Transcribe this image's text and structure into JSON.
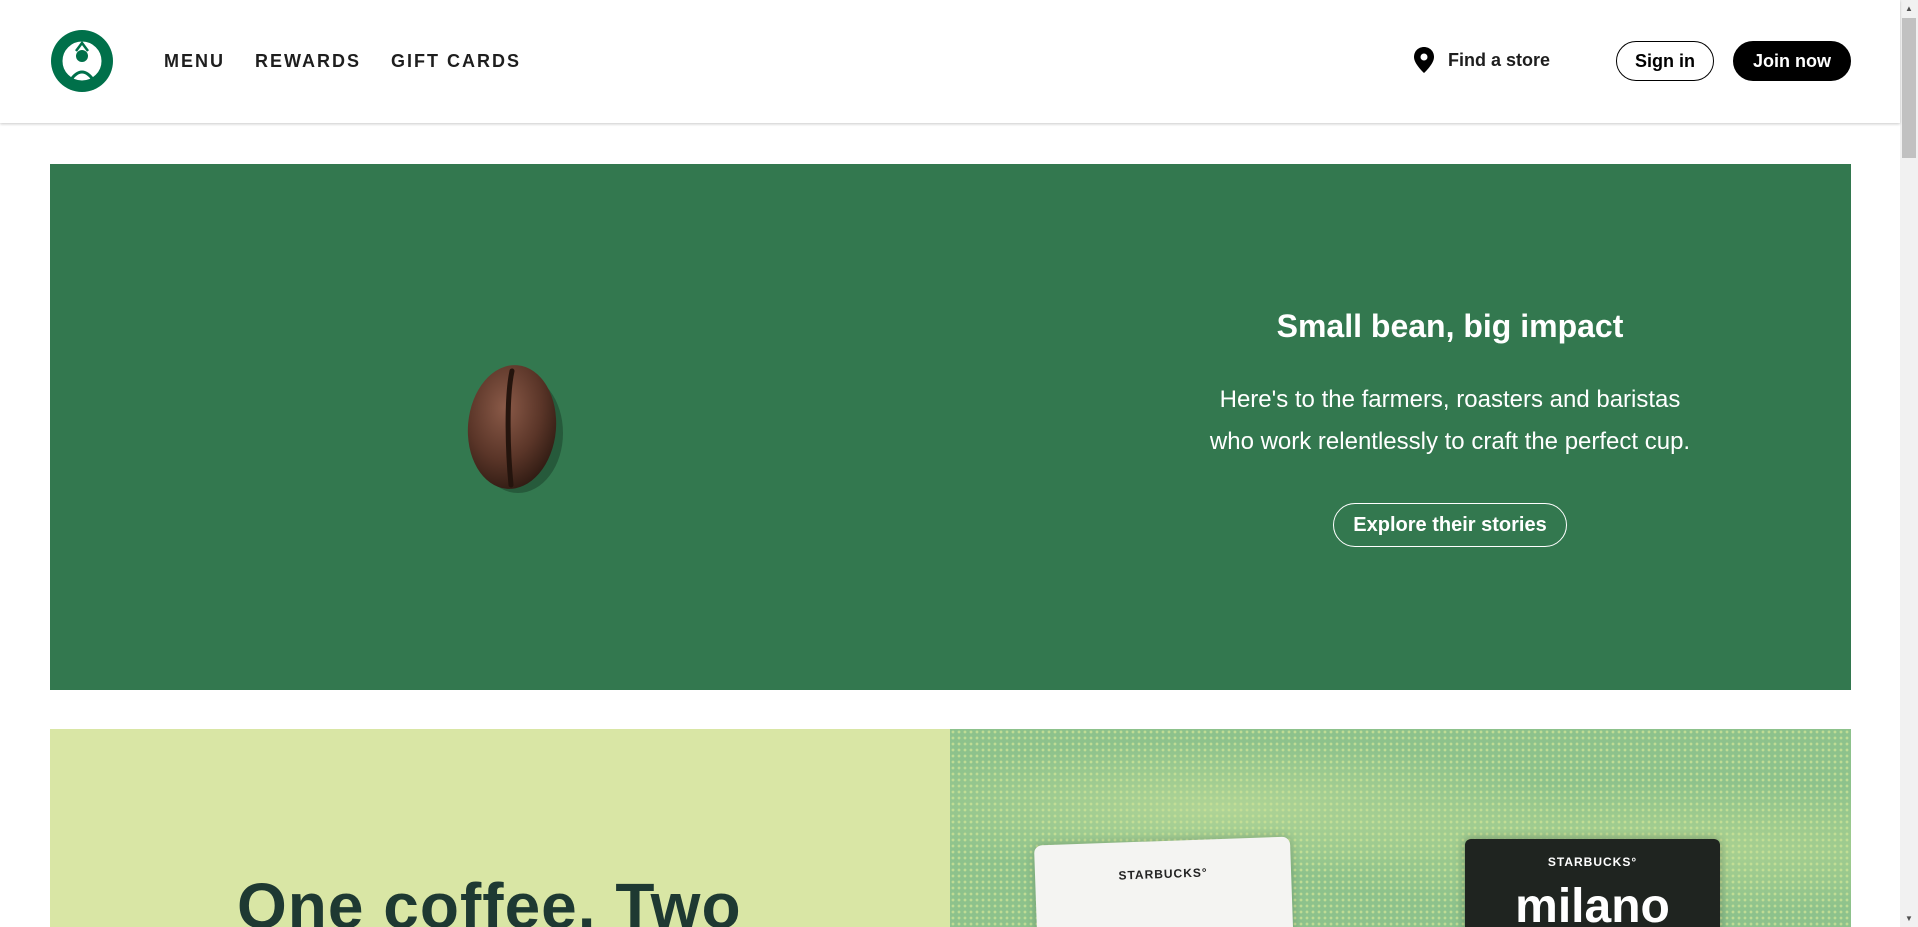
{
  "header": {
    "nav": {
      "menu": "MENU",
      "rewards": "REWARDS",
      "gift_cards": "GIFT CARDS"
    },
    "find_store": "Find a store",
    "sign_in": "Sign in",
    "join_now": "Join now",
    "logo_icon": "starbucks-siren-logo",
    "location_icon": "map-pin-icon"
  },
  "hero": {
    "title": "Small bean, big impact",
    "body": "Here's to the farmers, roasters and baristas who work relentlessly to craft the perfect cup.",
    "cta": "Explore their stories",
    "background_color": "#33784f"
  },
  "promo": {
    "headline": "One coffee. Two",
    "bag_left_brand": "STARBUCKS°",
    "bag_right_brand": "STARBUCKS°",
    "bag_right_name": "milano",
    "background_left": "#d9e6a5"
  }
}
